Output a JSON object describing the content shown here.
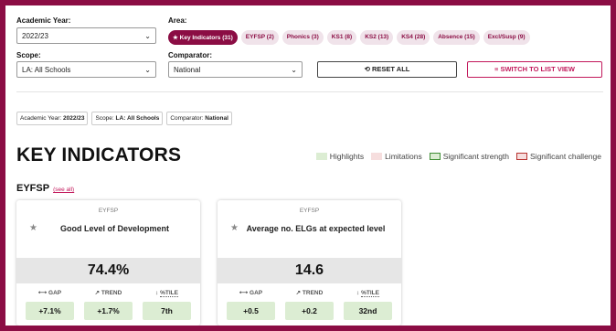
{
  "filters": {
    "academic_year": {
      "label": "Academic Year:",
      "value": "2022/23"
    },
    "area": {
      "label": "Area:"
    },
    "scope": {
      "label": "Scope:",
      "value": "LA: All Schools"
    },
    "comparator": {
      "label": "Comparator:",
      "value": "National"
    }
  },
  "area_chips": [
    {
      "label": "★ Key Indicators (31)",
      "active": true
    },
    {
      "label": "EYFSP (2)"
    },
    {
      "label": "Phonics (3)"
    },
    {
      "label": "KS1 (8)"
    },
    {
      "label": "KS2 (13)"
    },
    {
      "label": "KS4 (28)"
    },
    {
      "label": "Absence (15)"
    },
    {
      "label": "Excl/Susp (9)"
    }
  ],
  "buttons": {
    "reset": "⟲ RESET ALL",
    "list_view": "≡ SWITCH TO LIST VIEW"
  },
  "filter_tags": [
    {
      "key": "Academic Year:",
      "value": "2022/23"
    },
    {
      "key": "Scope:",
      "value": "LA: All Schools"
    },
    {
      "key": "Comparator:",
      "value": "National"
    }
  ],
  "page_title": "KEY INDICATORS",
  "legend": [
    {
      "label": "Highlights",
      "color": "#dcedd3",
      "border": "#dcedd3"
    },
    {
      "label": "Limitations",
      "color": "#f6dede",
      "border": "#f6dede"
    },
    {
      "label": "Significant strength",
      "color": "#dcedd3",
      "border": "#3f8f35"
    },
    {
      "label": "Significant challenge",
      "color": "#f6dede",
      "border": "#b8322f"
    }
  ],
  "section": {
    "title": "EYFSP",
    "see_all": "(see all)"
  },
  "metric_labels": {
    "gap": "⟷ GAP",
    "trend": "↗ TREND",
    "ptile_prefix": "↕ ",
    "ptile": "%TILE"
  },
  "cards": [
    {
      "category": "EYFSP",
      "name": "Good Level of Development",
      "value": "74.4%",
      "gap": "+7.1%",
      "trend": "+1.7%",
      "ptile": "7th"
    },
    {
      "category": "EYFSP",
      "name": "Average no. ELGs at expected level",
      "value": "14.6",
      "gap": "+0.5",
      "trend": "+0.2",
      "ptile": "32nd"
    }
  ],
  "icons": {
    "star": "★",
    "chevron": "⌄"
  }
}
